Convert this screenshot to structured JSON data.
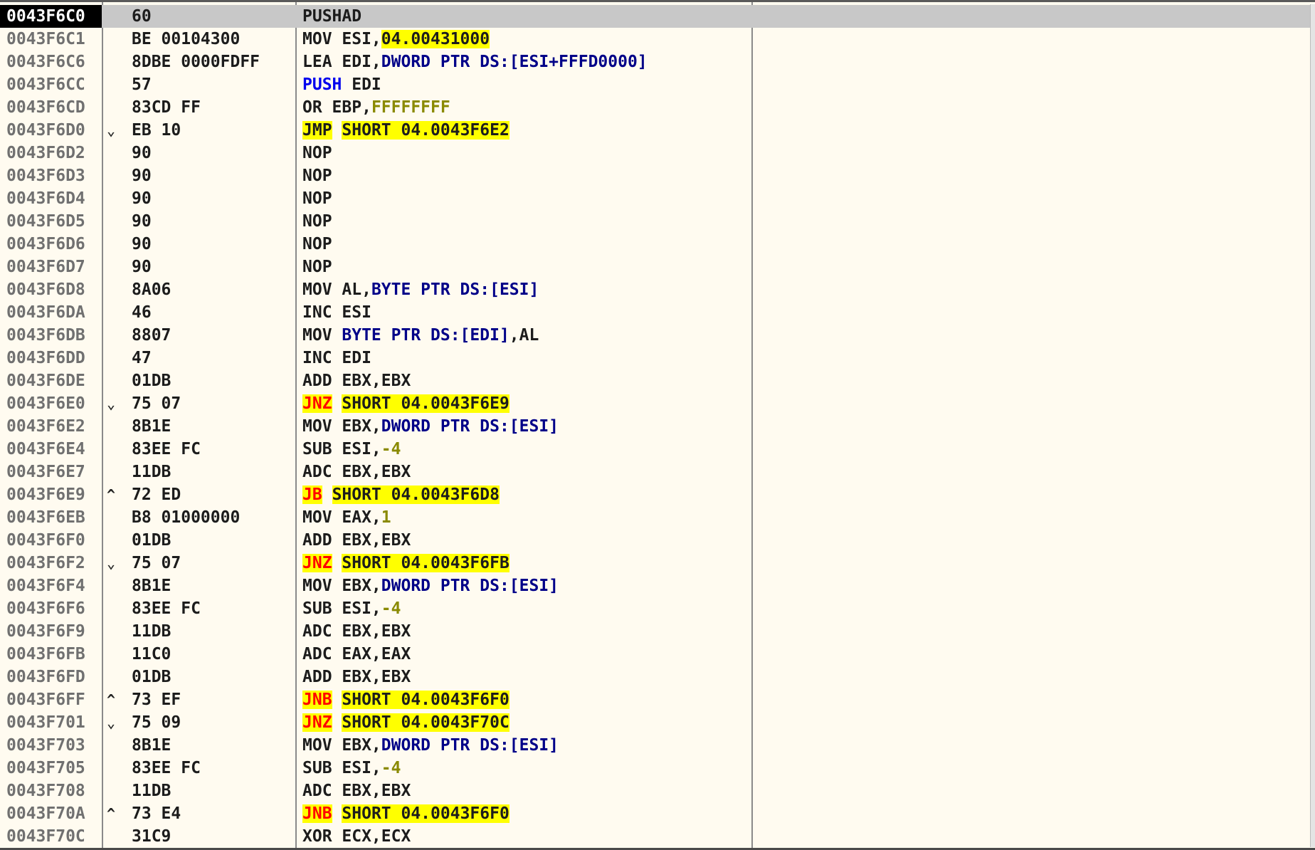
{
  "rows": [
    {
      "addr": "0043F6C0",
      "hex": "60",
      "arrow": "",
      "sel": true,
      "asm": [
        {
          "t": "PUSHAD"
        }
      ]
    },
    {
      "addr": "0043F6C1",
      "hex": "BE 00104300",
      "arrow": "",
      "asm": [
        {
          "t": "MOV ESI,"
        },
        {
          "t": "04.00431000",
          "c": "hl"
        }
      ]
    },
    {
      "addr": "0043F6C6",
      "hex": "8DBE 0000FDFF",
      "arrow": "",
      "asm": [
        {
          "t": "LEA EDI,"
        },
        {
          "t": "DWORD PTR DS:[ESI+FFFD0000]",
          "c": "ptr"
        }
      ]
    },
    {
      "addr": "0043F6CC",
      "hex": "57",
      "arrow": "",
      "asm": [
        {
          "t": "PUSH",
          "c": "pushc"
        },
        {
          "t": " EDI"
        }
      ]
    },
    {
      "addr": "0043F6CD",
      "hex": "83CD FF",
      "arrow": "",
      "asm": [
        {
          "t": "OR EBP,"
        },
        {
          "t": "FFFFFFFF",
          "c": "num"
        }
      ]
    },
    {
      "addr": "0043F6D0",
      "hex": "EB 10",
      "arrow": "⌄",
      "asm": [
        {
          "t": "JMP",
          "c": "hl"
        },
        {
          "t": " "
        },
        {
          "t": "SHORT 04.0043F6E2",
          "c": "hl"
        }
      ]
    },
    {
      "addr": "0043F6D2",
      "hex": "90",
      "arrow": "",
      "asm": [
        {
          "t": "NOP"
        }
      ]
    },
    {
      "addr": "0043F6D3",
      "hex": "90",
      "arrow": "",
      "asm": [
        {
          "t": "NOP"
        }
      ]
    },
    {
      "addr": "0043F6D4",
      "hex": "90",
      "arrow": "",
      "asm": [
        {
          "t": "NOP"
        }
      ]
    },
    {
      "addr": "0043F6D5",
      "hex": "90",
      "arrow": "",
      "asm": [
        {
          "t": "NOP"
        }
      ]
    },
    {
      "addr": "0043F6D6",
      "hex": "90",
      "arrow": "",
      "asm": [
        {
          "t": "NOP"
        }
      ]
    },
    {
      "addr": "0043F6D7",
      "hex": "90",
      "arrow": "",
      "asm": [
        {
          "t": "NOP"
        }
      ]
    },
    {
      "addr": "0043F6D8",
      "hex": "8A06",
      "arrow": "",
      "asm": [
        {
          "t": "MOV AL,"
        },
        {
          "t": "BYTE PTR DS:[ESI]",
          "c": "ptr"
        }
      ]
    },
    {
      "addr": "0043F6DA",
      "hex": "46",
      "arrow": "",
      "asm": [
        {
          "t": "INC ESI"
        }
      ]
    },
    {
      "addr": "0043F6DB",
      "hex": "8807",
      "arrow": "",
      "asm": [
        {
          "t": "MOV "
        },
        {
          "t": "BYTE PTR DS:[EDI]",
          "c": "ptr"
        },
        {
          "t": ",AL"
        }
      ]
    },
    {
      "addr": "0043F6DD",
      "hex": "47",
      "arrow": "",
      "asm": [
        {
          "t": "INC EDI"
        }
      ]
    },
    {
      "addr": "0043F6DE",
      "hex": "01DB",
      "arrow": "",
      "asm": [
        {
          "t": "ADD EBX,EBX"
        }
      ]
    },
    {
      "addr": "0043F6E0",
      "hex": "75 07",
      "arrow": "⌄",
      "asm": [
        {
          "t": "JNZ",
          "c": "hl jr"
        },
        {
          "t": " "
        },
        {
          "t": "SHORT 04.0043F6E9",
          "c": "hl"
        }
      ]
    },
    {
      "addr": "0043F6E2",
      "hex": "8B1E",
      "arrow": "",
      "asm": [
        {
          "t": "MOV EBX,"
        },
        {
          "t": "DWORD PTR DS:[ESI]",
          "c": "ptr"
        }
      ]
    },
    {
      "addr": "0043F6E4",
      "hex": "83EE FC",
      "arrow": "",
      "asm": [
        {
          "t": "SUB ESI,"
        },
        {
          "t": "-4",
          "c": "num"
        }
      ]
    },
    {
      "addr": "0043F6E7",
      "hex": "11DB",
      "arrow": "",
      "asm": [
        {
          "t": "ADC EBX,EBX"
        }
      ]
    },
    {
      "addr": "0043F6E9",
      "hex": "72 ED",
      "arrow": "^",
      "asm": [
        {
          "t": "JB",
          "c": "hl jr"
        },
        {
          "t": " "
        },
        {
          "t": "SHORT 04.0043F6D8",
          "c": "hl"
        }
      ]
    },
    {
      "addr": "0043F6EB",
      "hex": "B8 01000000",
      "arrow": "",
      "asm": [
        {
          "t": "MOV EAX,"
        },
        {
          "t": "1",
          "c": "num"
        }
      ]
    },
    {
      "addr": "0043F6F0",
      "hex": "01DB",
      "arrow": "",
      "asm": [
        {
          "t": "ADD EBX,EBX"
        }
      ]
    },
    {
      "addr": "0043F6F2",
      "hex": "75 07",
      "arrow": "⌄",
      "asm": [
        {
          "t": "JNZ",
          "c": "hl jr"
        },
        {
          "t": " "
        },
        {
          "t": "SHORT 04.0043F6FB",
          "c": "hl"
        }
      ]
    },
    {
      "addr": "0043F6F4",
      "hex": "8B1E",
      "arrow": "",
      "asm": [
        {
          "t": "MOV EBX,"
        },
        {
          "t": "DWORD PTR DS:[ESI]",
          "c": "ptr"
        }
      ]
    },
    {
      "addr": "0043F6F6",
      "hex": "83EE FC",
      "arrow": "",
      "asm": [
        {
          "t": "SUB ESI,"
        },
        {
          "t": "-4",
          "c": "num"
        }
      ]
    },
    {
      "addr": "0043F6F9",
      "hex": "11DB",
      "arrow": "",
      "asm": [
        {
          "t": "ADC EBX,EBX"
        }
      ]
    },
    {
      "addr": "0043F6FB",
      "hex": "11C0",
      "arrow": "",
      "asm": [
        {
          "t": "ADC EAX,EAX"
        }
      ]
    },
    {
      "addr": "0043F6FD",
      "hex": "01DB",
      "arrow": "",
      "asm": [
        {
          "t": "ADD EBX,EBX"
        }
      ]
    },
    {
      "addr": "0043F6FF",
      "hex": "73 EF",
      "arrow": "^",
      "asm": [
        {
          "t": "JNB",
          "c": "hl jr"
        },
        {
          "t": " "
        },
        {
          "t": "SHORT 04.0043F6F0",
          "c": "hl"
        }
      ]
    },
    {
      "addr": "0043F701",
      "hex": "75 09",
      "arrow": "⌄",
      "asm": [
        {
          "t": "JNZ",
          "c": "hl jr"
        },
        {
          "t": " "
        },
        {
          "t": "SHORT 04.0043F70C",
          "c": "hl"
        }
      ]
    },
    {
      "addr": "0043F703",
      "hex": "8B1E",
      "arrow": "",
      "asm": [
        {
          "t": "MOV EBX,"
        },
        {
          "t": "DWORD PTR DS:[ESI]",
          "c": "ptr"
        }
      ]
    },
    {
      "addr": "0043F705",
      "hex": "83EE FC",
      "arrow": "",
      "asm": [
        {
          "t": "SUB ESI,"
        },
        {
          "t": "-4",
          "c": "num"
        }
      ]
    },
    {
      "addr": "0043F708",
      "hex": "11DB",
      "arrow": "",
      "asm": [
        {
          "t": "ADC EBX,EBX"
        }
      ]
    },
    {
      "addr": "0043F70A",
      "hex": "73 E4",
      "arrow": "^",
      "asm": [
        {
          "t": "JNB",
          "c": "hl jr"
        },
        {
          "t": " "
        },
        {
          "t": "SHORT 04.0043F6F0",
          "c": "hl"
        }
      ]
    },
    {
      "addr": "0043F70C",
      "hex": "31C9",
      "arrow": "",
      "asm": [
        {
          "t": "XOR ECX,ECX"
        }
      ]
    }
  ]
}
